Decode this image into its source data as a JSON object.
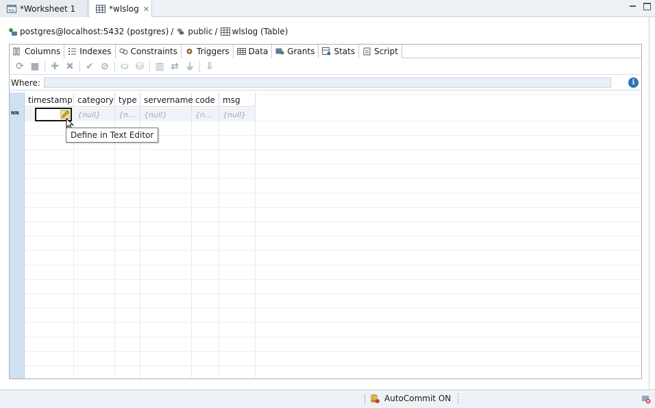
{
  "editor_tabs": [
    {
      "label": "*Worksheet 1",
      "active": false
    },
    {
      "label": "*wlslog",
      "active": true,
      "close": "✕"
    }
  ],
  "breadcrumb": {
    "connection": "postgres@localhost:5432 (postgres)",
    "separator": "/",
    "schema": "public",
    "table": "wlslog (Table)"
  },
  "subtabs": [
    {
      "label": "Columns",
      "icon": "columns-icon"
    },
    {
      "label": "Indexes",
      "icon": "indexes-icon"
    },
    {
      "label": "Constraints",
      "icon": "constraints-icon"
    },
    {
      "label": "Triggers",
      "icon": "triggers-icon"
    },
    {
      "label": "Data",
      "icon": "data-icon"
    },
    {
      "label": "Grants",
      "icon": "grants-icon"
    },
    {
      "label": "Stats",
      "icon": "stats-icon"
    },
    {
      "label": "Script",
      "icon": "script-icon"
    }
  ],
  "where": {
    "label": "Where:",
    "value": "",
    "info": "i"
  },
  "grid": {
    "columns": [
      "timestamp",
      "category",
      "type",
      "servername",
      "code",
      "msg"
    ],
    "row": [
      "",
      "{null}",
      "{n...",
      "{null}",
      "{n...",
      "{null}"
    ],
    "not_null_marker": "NN"
  },
  "tooltip": "Define in Text Editor",
  "status": {
    "autocommit": "AutoCommit ON"
  },
  "colors": {
    "row_header": "#cfe0f2",
    "where_input": "#e9f0f8",
    "info": "#2c74b3"
  }
}
